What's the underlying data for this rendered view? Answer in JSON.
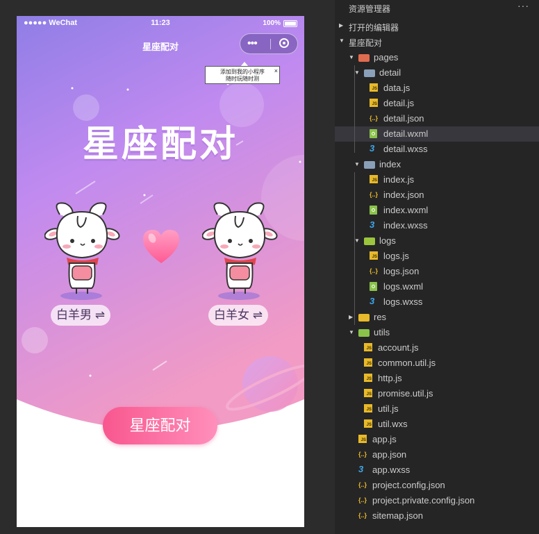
{
  "simulator": {
    "status": {
      "carrier": "●●●●● WeChat",
      "time": "11:23",
      "battery": "100%"
    },
    "nav_title": "星座配对",
    "capsule": {
      "more": "•••",
      "target": "target-icon"
    },
    "tooltip": {
      "line1": "添加到我的小程序",
      "line2": "随时玩随时测",
      "close": "×"
    },
    "heading": "星座配对",
    "left_sign": "白羊男 ⇌",
    "right_sign": "白羊女 ⇌",
    "cta": "星座配对",
    "colors": {
      "bg_top": "#9b7fe6",
      "bg_mid": "#c58bf0",
      "bg_bottom": "#f19ac2",
      "accent": "#f8578e"
    }
  },
  "explorer": {
    "title": "资源管理器",
    "more": "···",
    "section_open": "打开的编辑器",
    "section_project": "星座配对",
    "items": [
      {
        "label": "pages",
        "icon": "folder-pages",
        "kind": "folder",
        "open": true,
        "depth": 0
      },
      {
        "label": "detail",
        "icon": "folder",
        "kind": "folder",
        "open": true,
        "depth": 1
      },
      {
        "label": "data.js",
        "icon": "js",
        "kind": "file",
        "depth": 2
      },
      {
        "label": "detail.js",
        "icon": "js",
        "kind": "file",
        "depth": 2
      },
      {
        "label": "detail.json",
        "icon": "json",
        "kind": "file",
        "depth": 2
      },
      {
        "label": "detail.wxml",
        "icon": "wxml",
        "kind": "file",
        "depth": 2,
        "selected": true
      },
      {
        "label": "detail.wxss",
        "icon": "wxss",
        "kind": "file",
        "depth": 2
      },
      {
        "label": "index",
        "icon": "folder",
        "kind": "folder",
        "open": true,
        "depth": 1
      },
      {
        "label": "index.js",
        "icon": "js",
        "kind": "file",
        "depth": 2
      },
      {
        "label": "index.json",
        "icon": "json",
        "kind": "file",
        "depth": 2
      },
      {
        "label": "index.wxml",
        "icon": "wxml",
        "kind": "file",
        "depth": 2
      },
      {
        "label": "index.wxss",
        "icon": "wxss",
        "kind": "file",
        "depth": 2
      },
      {
        "label": "logs",
        "icon": "folder-logs",
        "kind": "folder",
        "open": true,
        "depth": 1
      },
      {
        "label": "logs.js",
        "icon": "js",
        "kind": "file",
        "depth": 2
      },
      {
        "label": "logs.json",
        "icon": "json",
        "kind": "file",
        "depth": 2
      },
      {
        "label": "logs.wxml",
        "icon": "wxml",
        "kind": "file",
        "depth": 2
      },
      {
        "label": "logs.wxss",
        "icon": "wxss",
        "kind": "file",
        "depth": 2
      },
      {
        "label": "res",
        "icon": "folder-res",
        "kind": "folder",
        "open": false,
        "depth": 0
      },
      {
        "label": "utils",
        "icon": "folder-utils",
        "kind": "folder",
        "open": true,
        "depth": 0
      },
      {
        "label": "account.js",
        "icon": "js",
        "kind": "file",
        "depth": 1
      },
      {
        "label": "common.util.js",
        "icon": "js",
        "kind": "file",
        "depth": 1
      },
      {
        "label": "http.js",
        "icon": "js",
        "kind": "file",
        "depth": 1
      },
      {
        "label": "promise.util.js",
        "icon": "js",
        "kind": "file",
        "depth": 1
      },
      {
        "label": "util.js",
        "icon": "js",
        "kind": "file",
        "depth": 1
      },
      {
        "label": "util.wxs",
        "icon": "js",
        "kind": "file",
        "depth": 1
      },
      {
        "label": "app.js",
        "icon": "js",
        "kind": "file",
        "depth": 0
      },
      {
        "label": "app.json",
        "icon": "json",
        "kind": "file",
        "depth": 0
      },
      {
        "label": "app.wxss",
        "icon": "wxss",
        "kind": "file",
        "depth": 0
      },
      {
        "label": "project.config.json",
        "icon": "json",
        "kind": "file",
        "depth": 0
      },
      {
        "label": "project.private.config.json",
        "icon": "json",
        "kind": "file",
        "depth": 0
      },
      {
        "label": "sitemap.json",
        "icon": "json",
        "kind": "file",
        "depth": 0
      }
    ]
  }
}
